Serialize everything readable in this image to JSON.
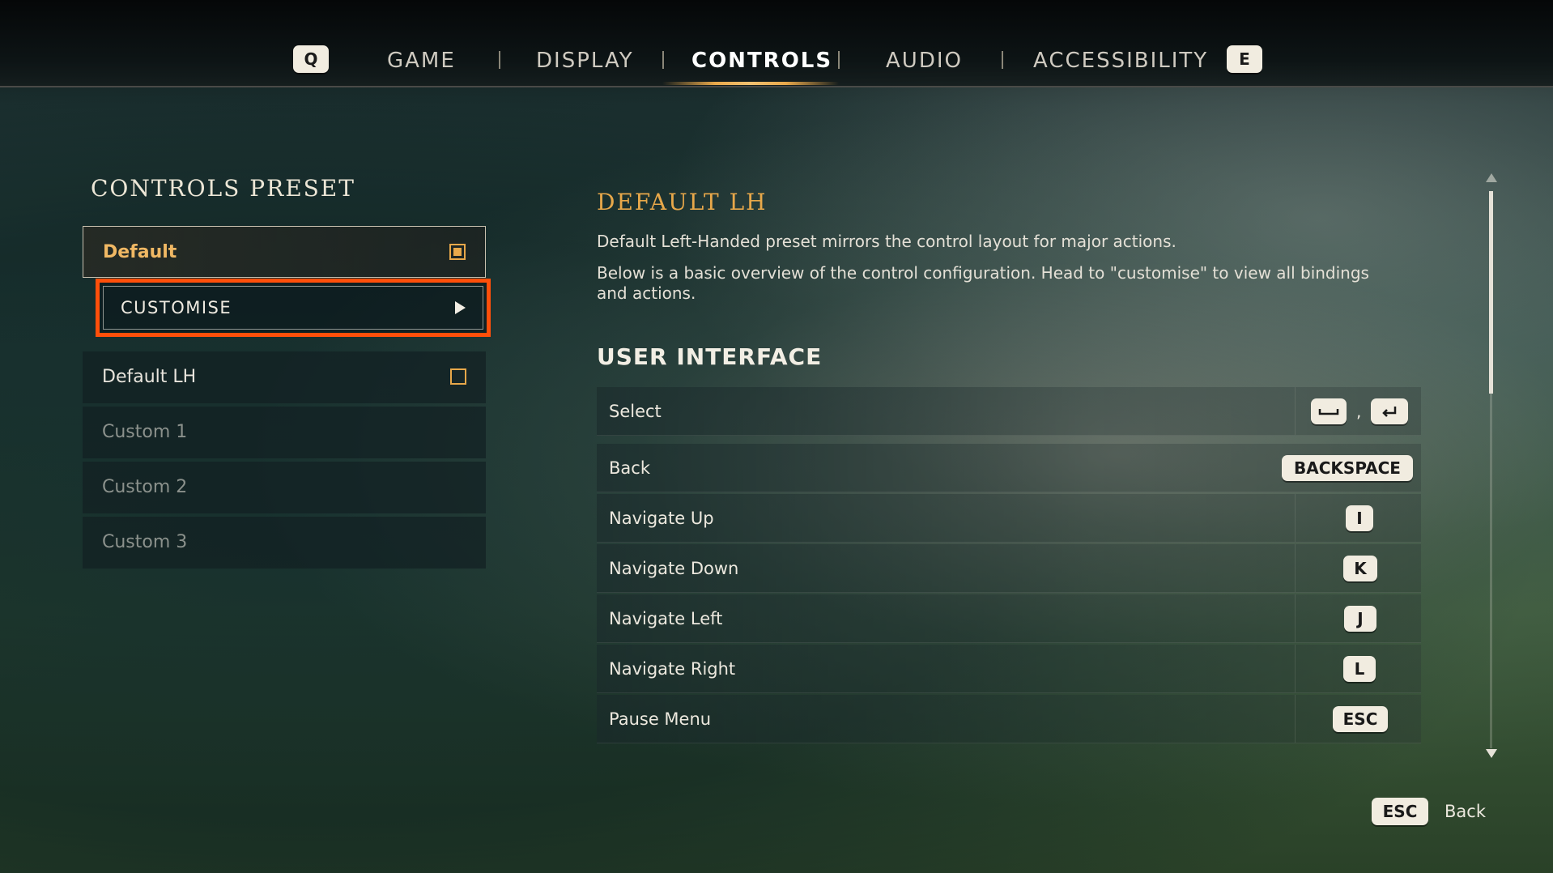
{
  "tabs": {
    "prev_key": "Q",
    "next_key": "E",
    "items": [
      {
        "label": "GAME"
      },
      {
        "label": "DISPLAY"
      },
      {
        "label": "CONTROLS"
      },
      {
        "label": "AUDIO"
      },
      {
        "label": "ACCESSIBILITY"
      }
    ],
    "active": "CONTROLS"
  },
  "presets": {
    "title": "CONTROLS PRESET",
    "items": [
      {
        "label": "Default",
        "selected": true
      },
      {
        "label": "CUSTOMISE"
      },
      {
        "label": "Default LH",
        "selected": false
      },
      {
        "label": "Custom 1"
      },
      {
        "label": "Custom 2"
      },
      {
        "label": "Custom 3"
      }
    ]
  },
  "detail": {
    "title": "DEFAULT LH",
    "desc1": "Default Left-Handed preset mirrors the control layout for major actions.",
    "desc2": "Below is a basic overview of the control configuration. Head to \"customise\" to view all bindings and actions.",
    "section": "USER INTERFACE",
    "rows": [
      {
        "action": "Select",
        "bindings": [
          "space-key-icon",
          "enter-key-icon"
        ]
      },
      {
        "action": "Back",
        "binding": "BACKSPACE"
      },
      {
        "action": "Navigate Up",
        "binding": "I"
      },
      {
        "action": "Navigate Down",
        "binding": "K"
      },
      {
        "action": "Navigate Left",
        "binding": "J"
      },
      {
        "action": "Navigate Right",
        "binding": "L"
      },
      {
        "action": "Pause Menu",
        "binding": "ESC"
      }
    ],
    "comma": ","
  },
  "footer": {
    "key": "ESC",
    "label": "Back"
  },
  "colors": {
    "accent": "#e8a84a",
    "highlight": "#ff4f0a",
    "keycap": "#f1ece0"
  }
}
